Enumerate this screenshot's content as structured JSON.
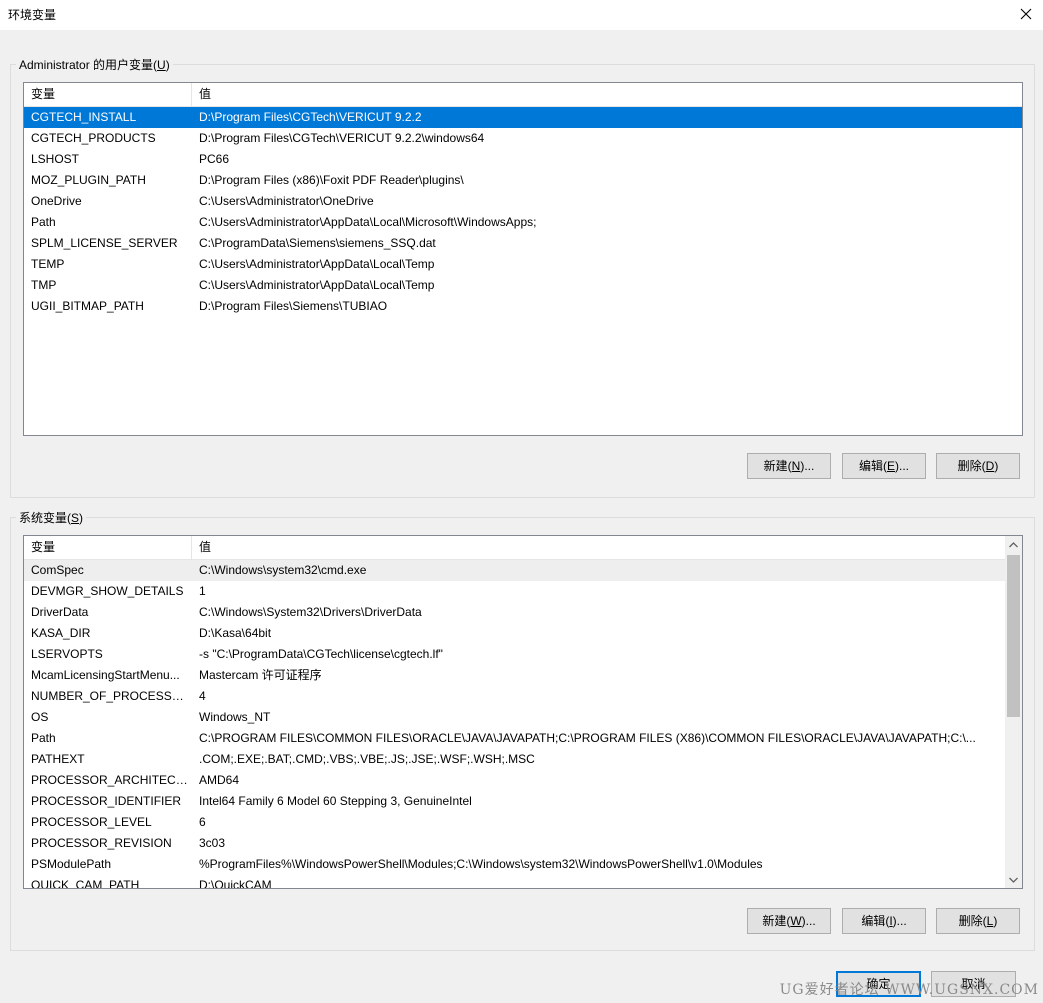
{
  "window": {
    "title": "环境变量"
  },
  "user_vars": {
    "group_label": "Administrator 的用户变量(",
    "group_hotkey": "U",
    "group_suffix": ")",
    "col_name": "变量",
    "col_value": "值",
    "rows": [
      {
        "name": "CGTECH_INSTALL",
        "value": "D:\\Program Files\\CGTech\\VERICUT 9.2.2"
      },
      {
        "name": "CGTECH_PRODUCTS",
        "value": "D:\\Program Files\\CGTech\\VERICUT 9.2.2\\windows64"
      },
      {
        "name": "LSHOST",
        "value": "PC66"
      },
      {
        "name": "MOZ_PLUGIN_PATH",
        "value": "D:\\Program Files (x86)\\Foxit PDF Reader\\plugins\\"
      },
      {
        "name": "OneDrive",
        "value": "C:\\Users\\Administrator\\OneDrive"
      },
      {
        "name": "Path",
        "value": "C:\\Users\\Administrator\\AppData\\Local\\Microsoft\\WindowsApps;"
      },
      {
        "name": "SPLM_LICENSE_SERVER",
        "value": "C:\\ProgramData\\Siemens\\siemens_SSQ.dat"
      },
      {
        "name": "TEMP",
        "value": "C:\\Users\\Administrator\\AppData\\Local\\Temp"
      },
      {
        "name": "TMP",
        "value": "C:\\Users\\Administrator\\AppData\\Local\\Temp"
      },
      {
        "name": "UGII_BITMAP_PATH",
        "value": "D:\\Program Files\\Siemens\\TUBIAO"
      }
    ],
    "selected_index": 0,
    "buttons": {
      "new": {
        "pre": "新建(",
        "key": "N",
        "post": ")..."
      },
      "edit": {
        "pre": "编辑(",
        "key": "E",
        "post": ")..."
      },
      "delete": {
        "pre": "删除(",
        "key": "D",
        "post": ")"
      }
    }
  },
  "system_vars": {
    "group_label": "系统变量(",
    "group_hotkey": "S",
    "group_suffix": ")",
    "col_name": "变量",
    "col_value": "值",
    "rows": [
      {
        "name": "ComSpec",
        "value": "C:\\Windows\\system32\\cmd.exe"
      },
      {
        "name": "DEVMGR_SHOW_DETAILS",
        "value": "1"
      },
      {
        "name": "DriverData",
        "value": "C:\\Windows\\System32\\Drivers\\DriverData"
      },
      {
        "name": "KASA_DIR",
        "value": "D:\\Kasa\\64bit"
      },
      {
        "name": "LSERVOPTS",
        "value": "-s \"C:\\ProgramData\\CGTech\\license\\cgtech.lf\""
      },
      {
        "name": "McamLicensingStartMenu...",
        "value": "Mastercam 许可证程序"
      },
      {
        "name": "NUMBER_OF_PROCESSORS",
        "value": "4"
      },
      {
        "name": "OS",
        "value": "Windows_NT"
      },
      {
        "name": "Path",
        "value": "C:\\PROGRAM FILES\\COMMON FILES\\ORACLE\\JAVA\\JAVAPATH;C:\\PROGRAM FILES (X86)\\COMMON FILES\\ORACLE\\JAVA\\JAVAPATH;C:\\..."
      },
      {
        "name": "PATHEXT",
        "value": ".COM;.EXE;.BAT;.CMD;.VBS;.VBE;.JS;.JSE;.WSF;.WSH;.MSC"
      },
      {
        "name": "PROCESSOR_ARCHITECT...",
        "value": "AMD64"
      },
      {
        "name": "PROCESSOR_IDENTIFIER",
        "value": "Intel64 Family 6 Model 60 Stepping 3, GenuineIntel"
      },
      {
        "name": "PROCESSOR_LEVEL",
        "value": "6"
      },
      {
        "name": "PROCESSOR_REVISION",
        "value": "3c03"
      },
      {
        "name": "PSModulePath",
        "value": "%ProgramFiles%\\WindowsPowerShell\\Modules;C:\\Windows\\system32\\WindowsPowerShell\\v1.0\\Modules"
      },
      {
        "name": "QUICK_CAM_PATH",
        "value": "D:\\QuickCAM"
      }
    ],
    "focused_index": 0,
    "buttons": {
      "new": {
        "pre": "新建(",
        "key": "W",
        "post": ")..."
      },
      "edit": {
        "pre": "编辑(",
        "key": "I",
        "post": ")..."
      },
      "delete": {
        "pre": "删除(",
        "key": "L",
        "post": ")"
      }
    }
  },
  "footer": {
    "ok": "确定",
    "cancel": "取消"
  },
  "watermark": "UG爱好者论坛 WWW.UGSNX.COM",
  "colors": {
    "selection": "#0078d7",
    "default_button_border": "#0078d7"
  }
}
